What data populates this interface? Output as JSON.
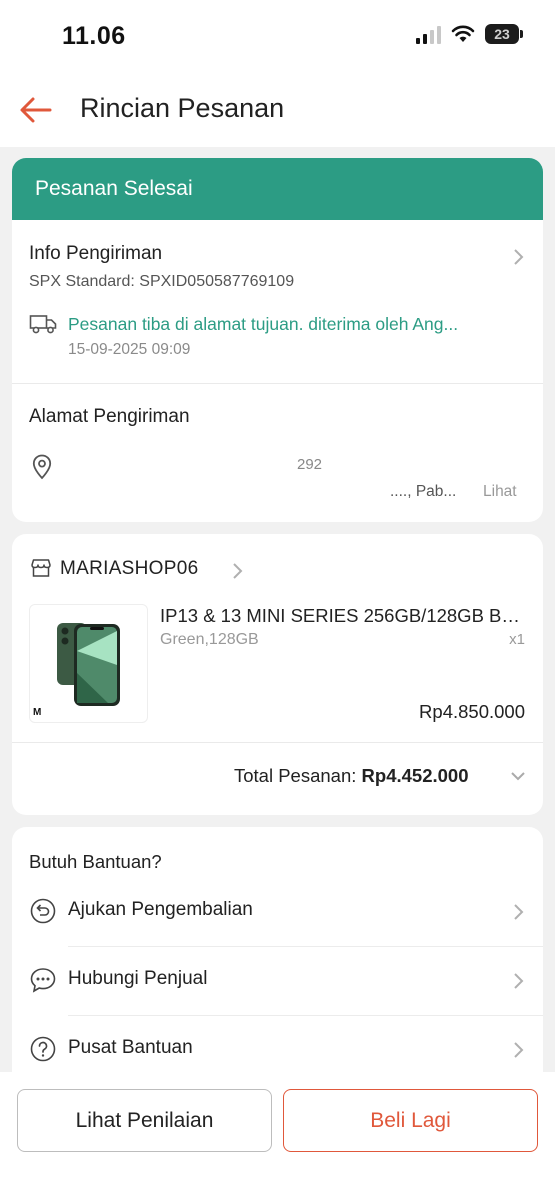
{
  "status_bar": {
    "time": "11.06",
    "battery": "23"
  },
  "header": {
    "title": "Rincian Pesanan"
  },
  "order_status": {
    "label": "Pesanan Selesai",
    "color": "#2c9c84"
  },
  "shipping": {
    "title": "Info Pengiriman",
    "tracking": "SPX Standard: SPXID050587769109",
    "status": "Pesanan tiba di alamat tujuan. diterima oleh Ang...",
    "date": "15-09-2025 09:09"
  },
  "address": {
    "title": "Alamat Pengiriman",
    "line1": "292",
    "line2": "...., Pab...",
    "view_link": "Lihat"
  },
  "shop": {
    "name": "MARIASHOP06",
    "product": {
      "name": "IP13 & 13 MINI SERIES 256GB/128GB BEKAS ORIGINAL",
      "variant": "Green,128GB",
      "qty": "x1",
      "price": "Rp4.850.000",
      "thumb_mark": "M"
    },
    "total_label": "Total Pesanan:",
    "total_value": "Rp4.452.000"
  },
  "help": {
    "title": "Butuh Bantuan?",
    "items": [
      {
        "label": "Ajukan Pengembalian",
        "icon": "return-icon"
      },
      {
        "label": "Hubungi Penjual",
        "icon": "chat-icon"
      },
      {
        "label": "Pusat Bantuan",
        "icon": "question-icon"
      }
    ]
  },
  "actions": {
    "rate_label": "Lihat Penilaian",
    "buy_again_label": "Beli Lagi",
    "accent_color": "#e0583b"
  }
}
